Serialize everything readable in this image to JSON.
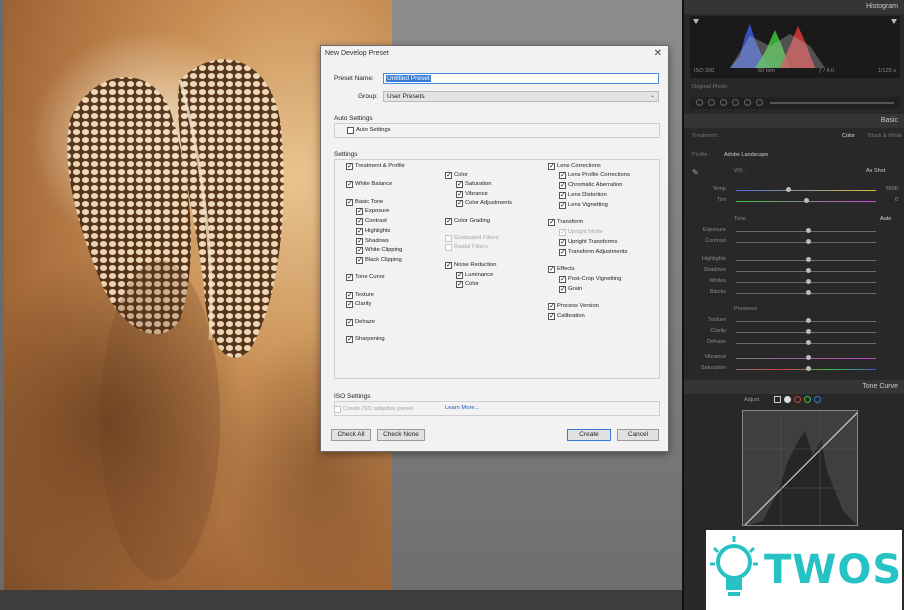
{
  "right_panel": {
    "histogram_label": "Histogram",
    "iso": "ISO 200",
    "focal": "60 mm",
    "aperture": "ƒ / 4.0",
    "shutter": "1/125 s",
    "original_photo": "Original Photo",
    "basic_label": "Basic",
    "treatment_label": "Treatment :",
    "treatment_color": "Color",
    "treatment_bw": "Black & White",
    "profile_label": "Profile :",
    "profile_value": "Adobe Landscape",
    "wb_label": "WB :",
    "wb_value": "As Shot",
    "temp_label": "Temp",
    "temp_value": "5500",
    "tint_label": "Tint",
    "tint_value": "0",
    "tone_label": "Tone",
    "tone_auto": "Auto",
    "exposure_label": "Exposure",
    "contrast_label": "Contrast",
    "highlights_label": "Highlights",
    "shadows_label": "Shadows",
    "whites_label": "Whites",
    "blacks_label": "Blacks",
    "presence_label": "Presence",
    "texture_label": "Texture",
    "clarity_label": "Clarity",
    "dehaze_label": "Dehaze",
    "vibrance_label": "Vibrance",
    "saturation_label": "Saturation",
    "tone_curve_label": "Tone Curve",
    "adjust_label": "Adjust"
  },
  "logo": {
    "text": "TWOS",
    "color": "#27c2c4"
  },
  "dialog": {
    "title": "New Develop Preset",
    "close": "✕",
    "preset_name_label": "Preset Name:",
    "preset_name_value": "Untitled Preset",
    "group_label": "Group:",
    "group_value": "User Presets",
    "auto_settings_title": "Auto Settings",
    "auto_settings_item": "Auto Settings",
    "settings_title": "Settings",
    "col1": {
      "treatment_profile": "Treatment & Profile",
      "white_balance": "White Balance",
      "basic_tone": "Basic Tone",
      "exposure": "Exposure",
      "contrast": "Contrast",
      "highlights": "Highlights",
      "shadows": "Shadows",
      "white_clipping": "White Clipping",
      "black_clipping": "Black Clipping",
      "tone_curve": "Tone Curve",
      "texture": "Texture",
      "clarity": "Clarity",
      "dehaze": "Dehaze",
      "sharpening": "Sharpening"
    },
    "col2": {
      "color": "Color",
      "saturation": "Saturation",
      "vibrance": "Vibrance",
      "color_adjustments": "Color Adjustments",
      "color_grading": "Color Grading",
      "graduated_filters": "Graduated Filters",
      "radial_filters": "Radial Filters",
      "noise_reduction": "Noise Reduction",
      "luminance": "Luminance",
      "color_nr": "Color"
    },
    "col3": {
      "lens_corrections": "Lens Corrections",
      "lens_profile": "Lens Profile Corrections",
      "chromatic": "Chromatic Aberration",
      "lens_distortion": "Lens Distortion",
      "lens_vignetting": "Lens Vignetting",
      "transform": "Transform",
      "upright_mode": "Upright Mode",
      "upright_transforms": "Upright Transforms",
      "transform_adjustments": "Transform Adjustments",
      "effects": "Effects",
      "post_crop": "Post-Crop Vignetting",
      "grain": "Grain",
      "process_version": "Process Version",
      "calibration": "Calibration"
    },
    "iso_title": "ISO Settings",
    "iso_item": "Create ISO adaptive preset",
    "learn_more": "Learn More...",
    "check_all": "Check All",
    "check_none": "Check None",
    "create": "Create",
    "cancel": "Cancel"
  }
}
